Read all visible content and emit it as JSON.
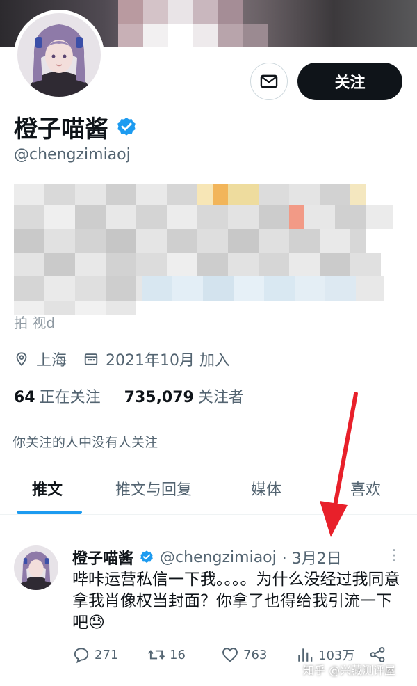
{
  "profile": {
    "display_name": "橙子喵酱",
    "handle": "@chengzimiaoj",
    "location": "上海",
    "joined": "2021年10月 加入",
    "bio_tail": "拍                     视d"
  },
  "buttons": {
    "message_icon": "mail-icon",
    "follow_label": "关注"
  },
  "stats": {
    "following_count": "64",
    "following_label": "正在关注",
    "followers_count": "735,079",
    "followers_label": "关注者"
  },
  "followed_by_note": "你关注的人中没有人关注",
  "tabs": [
    {
      "label": "推文",
      "active": true
    },
    {
      "label": "推文与回复",
      "active": false
    },
    {
      "label": "媒体",
      "active": false
    },
    {
      "label": "喜欢",
      "active": false
    }
  ],
  "tweet": {
    "author_name": "橙子喵酱",
    "author_handle": "@chengzimiaoj",
    "date": "· 3月2日",
    "text": "哔咔运营私信一下我。。。。为什么没经过我同意拿我肖像权当封面？你拿了也得给我引流一下吧😓",
    "replies": "271",
    "retweets": "16",
    "likes": "763",
    "views": "103万"
  },
  "watermark": "知乎 @兴藏测评屋",
  "colors": {
    "accent": "#1d9bf0",
    "text_primary": "#0f1419",
    "text_secondary": "#536471",
    "follow_button": "#0f1419",
    "annotation_arrow": "#e8202a"
  }
}
